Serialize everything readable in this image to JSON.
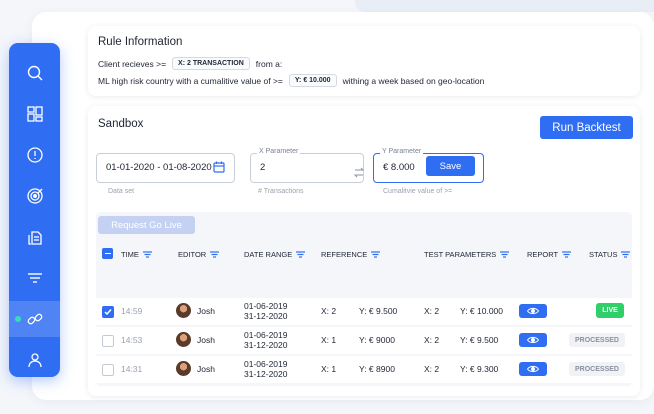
{
  "rule": {
    "title": "Rule Information",
    "line1_prefix": "Client recieves >=",
    "line1_chip": "X: 2 TRANSACTION",
    "line1_suffix": "from a:",
    "line2_prefix": "ML high risk country with a cumalitive value of >=",
    "line2_chip": "Y: € 10.000",
    "line2_suffix": "withing a week based on geo-location"
  },
  "sandbox": {
    "title": "Sandbox",
    "run_label": "Run Backtest",
    "dataset": {
      "value": "01-01-2020 - 01-08-2020",
      "help": "Data set"
    },
    "x_param": {
      "legend": "X Parameter",
      "value": "2",
      "help": "# Transactions"
    },
    "y_param": {
      "legend": "Y Parameter",
      "value": "€ 8.000",
      "help": "Cumalitvie value of >=",
      "save_label": "Save"
    },
    "golive_label": "Request Go Live"
  },
  "table": {
    "headers": {
      "time": "TIME",
      "editor": "EDITOR",
      "date_range": "DATE RANGE",
      "reference": "REFERENCE",
      "test_parameters": "TEST PARAMETERS",
      "report": "REPORT",
      "status": "STATUS"
    },
    "rows": [
      {
        "checked": true,
        "time": "14:59",
        "editor": "Josh",
        "date_start": "01-06-2019",
        "date_end": "31-12-2020",
        "ref_x": "X: 2",
        "ref_y": "Y: € 9.500",
        "test_x": "X: 2",
        "test_y": "Y: € 10.000",
        "status": "LIVE"
      },
      {
        "checked": false,
        "time": "14:53",
        "editor": "Josh",
        "date_start": "01-06-2019",
        "date_end": "31-12-2020",
        "ref_x": "X: 1",
        "ref_y": "Y: € 9000",
        "test_x": "X: 2",
        "test_y": "Y: € 9.500",
        "status": "PROCESSED"
      },
      {
        "checked": false,
        "time": "14:31",
        "editor": "Josh",
        "date_start": "01-06-2019",
        "date_end": "31-12-2020",
        "ref_x": "X: 1",
        "ref_y": "Y: € 8900",
        "test_x": "X: 2",
        "test_y": "Y: € 9.300",
        "status": "PROCESSED"
      }
    ]
  },
  "sidebar": {
    "items": [
      {
        "icon": "search-icon"
      },
      {
        "icon": "dashboard-grid-icon"
      },
      {
        "icon": "alert-circle-icon"
      },
      {
        "icon": "target-icon"
      },
      {
        "icon": "documents-icon"
      },
      {
        "icon": "filter-icon"
      },
      {
        "icon": "link-icon",
        "active": true
      },
      {
        "icon": "user-icon"
      }
    ]
  },
  "colors": {
    "primary": "#2f6df3",
    "live": "#2fcf6a",
    "processed_bg": "#f0f2f6",
    "active_dot": "#33e0b3"
  }
}
